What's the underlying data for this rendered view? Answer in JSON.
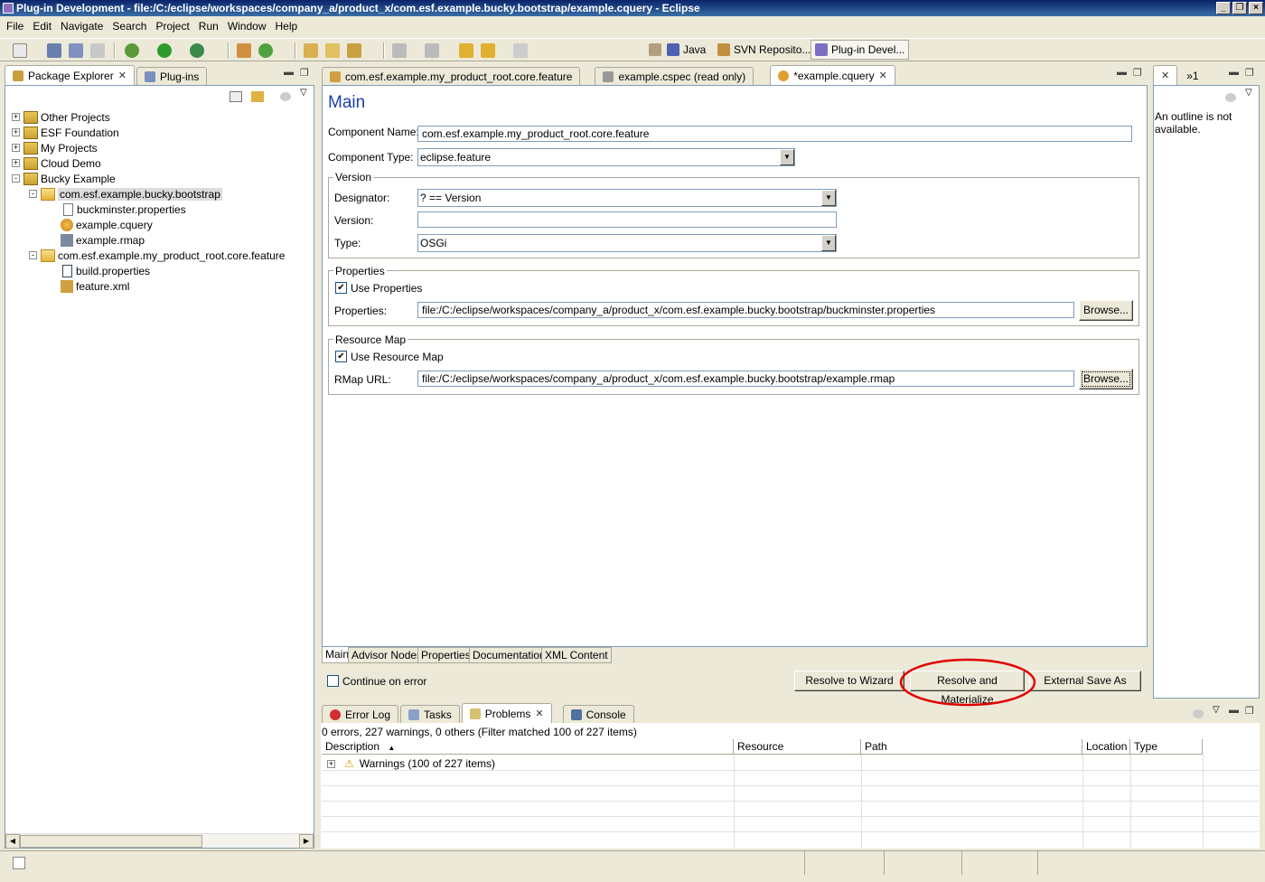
{
  "window": {
    "title": "Plug-in Development - file:/C:/eclipse/workspaces/company_a/product_x/com.esf.example.bucky.bootstrap/example.cquery - Eclipse",
    "min": "_",
    "max": "❐",
    "close": "×"
  },
  "menu": [
    "File",
    "Edit",
    "Navigate",
    "Search",
    "Project",
    "Run",
    "Window",
    "Help"
  ],
  "perspectives": [
    {
      "label": "",
      "icon": "open-perspective-icon"
    },
    {
      "label": "Java",
      "icon": "java-perspective-icon"
    },
    {
      "label": "SVN Reposito...",
      "icon": "svn-icon"
    },
    {
      "label": "Plug-in Devel...",
      "icon": "plugin-perspective-icon"
    }
  ],
  "left_tabs": [
    {
      "label": "Package Explorer",
      "active": true
    },
    {
      "label": "Plug-ins",
      "active": false
    }
  ],
  "tree": [
    {
      "label": "Other Projects",
      "level": 0,
      "expander": "+"
    },
    {
      "label": "ESF Foundation",
      "level": 0,
      "expander": "+"
    },
    {
      "label": "My Projects",
      "level": 0,
      "expander": "+"
    },
    {
      "label": "Cloud Demo",
      "level": 0,
      "expander": "+"
    },
    {
      "label": "Bucky Example",
      "level": 0,
      "expander": "-"
    },
    {
      "label": "com.esf.example.bucky.bootstrap",
      "level": 1,
      "expander": "-"
    },
    {
      "label": "buckminster.properties",
      "level": 2,
      "expander": ""
    },
    {
      "label": "example.cquery",
      "level": 2,
      "expander": ""
    },
    {
      "label": "example.rmap",
      "level": 2,
      "expander": ""
    },
    {
      "label": "com.esf.example.my_product_root.core.feature",
      "level": 1,
      "expander": "-"
    },
    {
      "label": "build.properties",
      "level": 2,
      "expander": ""
    },
    {
      "label": "feature.xml",
      "level": 2,
      "expander": ""
    }
  ],
  "editor_tabs": [
    {
      "label": "com.esf.example.my_product_root.core.feature",
      "active": false
    },
    {
      "label": "example.cspec (read only)",
      "active": false
    },
    {
      "label": "*example.cquery",
      "active": true
    }
  ],
  "form": {
    "heading": "Main",
    "component_name_label": "Component Name:",
    "component_name_value": "com.esf.example.my_product_root.core.feature",
    "component_type_label": "Component Type:",
    "component_type_value": "eclipse.feature",
    "version_group": "Version",
    "designator_label": "Designator:",
    "designator_value": "? == Version",
    "version_label": "Version:",
    "version_value": "",
    "type_label": "Type:",
    "type_value": "OSGi",
    "properties_group": "Properties",
    "use_properties_label": "Use Properties",
    "use_properties_checked": true,
    "properties_label": "Properties:",
    "properties_value": "file:/C:/eclipse/workspaces/company_a/product_x/com.esf.example.bucky.bootstrap/buckminster.properties",
    "browse_label": "Browse...",
    "resource_map_group": "Resource Map",
    "use_resource_map_label": "Use Resource Map",
    "use_resource_map_checked": true,
    "rmap_label": "RMap URL:",
    "rmap_value": "file:/C:/eclipse/workspaces/company_a/product_x/com.esf.example.bucky.bootstrap/example.rmap",
    "browse2_label": "Browse..."
  },
  "editor_subtabs": [
    "Main",
    "Advisor Nodes",
    "Properties",
    "Documentation",
    "XML Content"
  ],
  "bottom_actions": {
    "continue_on_error": "Continue on error",
    "resolve_wizard": "Resolve to Wizard",
    "resolve_materialize": "Resolve and Materialize",
    "external_save": "External Save As"
  },
  "outline": {
    "tab_label": "»1",
    "message": "An outline is not available."
  },
  "bottom_tabs": [
    {
      "label": "Error Log",
      "active": false
    },
    {
      "label": "Tasks",
      "active": false
    },
    {
      "label": "Problems",
      "active": true
    },
    {
      "label": "Console",
      "active": false
    }
  ],
  "problems": {
    "summary": "0 errors, 227 warnings, 0 others (Filter matched 100 of 227 items)",
    "columns": [
      "Description",
      "Resource",
      "Path",
      "Location",
      "Type"
    ],
    "rows": [
      {
        "description": "Warnings (100 of 227 items)",
        "expander": "+"
      }
    ]
  },
  "colors": {
    "highlight_ellipse": "#e00000",
    "heading": "#1c3fb0"
  }
}
